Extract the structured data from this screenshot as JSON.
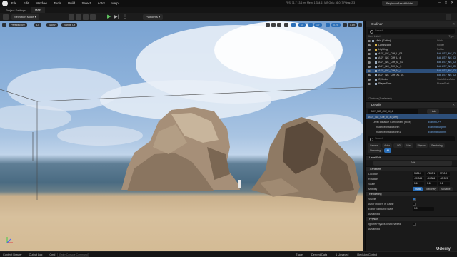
{
  "menu": [
    "File",
    "Edit",
    "Window",
    "Tools",
    "Build",
    "Select",
    "Actor",
    "Help"
  ],
  "stats": "FPS: 71.7   13.6 ms   Mem: 1,334.61 MB   Objs: 36,017   Prims: 2,3",
  "project_name": "BeginnerAssetHoldet",
  "tabs": {
    "project": "Project Settings",
    "level": "Main"
  },
  "toolbar": {
    "mode": "Selection Mode",
    "platforms": "Platforms"
  },
  "viewport": {
    "perspective": "Perspective",
    "lit": "Lit",
    "show": "Show",
    "buildhd": "Nanite Of",
    "snap1": "10",
    "snap2": "10°",
    "snap3": "0.25",
    "speed": "0.89"
  },
  "outliner": {
    "title": "Outliner",
    "search": "Search",
    "col_label": "Item Label",
    "col_type": "Type",
    "rows": [
      {
        "label": "Main (Editor)",
        "type": "World"
      },
      {
        "label": "Landscape",
        "type": "Folder"
      },
      {
        "label": "Lighting",
        "type": "Folder"
      },
      {
        "label": "ASY_NC_Cliff_L_03",
        "type": "Edit ASY_NC_Cli"
      },
      {
        "label": "ASY_NC_Cliff_L_4",
        "type": "Edit ASY_NC_Cli"
      },
      {
        "label": "ASY_NC_Cliff_M_02",
        "type": "Edit ASY_NC_Cli"
      },
      {
        "label": "ASY_NC_Cliff_M_3",
        "type": "Edit ASY_NC_Cli"
      },
      {
        "label": "ASY_NC_Cliff_M_4",
        "type": "Edit ASY_NC_Cli"
      },
      {
        "label": "ASY_NC_Cliff_XL_01",
        "type": "Edit ASY_NC_Cli"
      },
      {
        "label": "Cylinder",
        "type": "StaticMeshActor"
      },
      {
        "label": "PlayerStart",
        "type": "PlayerStart"
      }
    ],
    "footer": "17 actors (1 selected)"
  },
  "details": {
    "title": "Details",
    "actor": "ASY_NC_Cliff_M_4",
    "add": "+ Add",
    "instance": "ASY_NC_Cliff_M_4 (Self)",
    "components": [
      {
        "label": "Level Instance Component (Root)",
        "action": "Edit in C++"
      },
      {
        "label": "InstancedStaticMesh",
        "action": "Edit in Blueprint"
      },
      {
        "label": "InstancedStaticMesh1",
        "action": "Edit in Blueprint"
      }
    ],
    "search": "Search",
    "categories": [
      "General",
      "Actor",
      "LOD",
      "Misc",
      "Physics",
      "Rendering",
      "Streaming",
      "All"
    ],
    "level_edit": {
      "section": "Level Edit",
      "button": "Edit"
    },
    "transform": {
      "section": "Transform",
      "rows": [
        {
          "name": "Location",
          "x": "3086.0",
          "y": "-7853.1",
          "z": "7740.9"
        },
        {
          "name": "Rotation",
          "x": "-30.344",
          "y": "-34.386",
          "z": "-13.929"
        },
        {
          "name": "Scale",
          "x": "1.6",
          "y": "1.6",
          "z": "1.6"
        }
      ],
      "mobility": {
        "label": "Mobility",
        "options": [
          "Static",
          "Stationary",
          "Movable"
        ]
      }
    },
    "rendering": {
      "section": "Rendering",
      "rows": [
        {
          "label": "Visible",
          "checked": true
        },
        {
          "label": "Actor Hidden In Game",
          "checked": false
        },
        {
          "label": "Editor Billboard Scale",
          "value": "1.0"
        }
      ],
      "advanced": "Advanced"
    },
    "physics": {
      "section": "Physics",
      "row": "Ignore Physics Test Enabled",
      "advanced": "Advanced"
    }
  },
  "bottombar": {
    "drawer": "Content Drawer",
    "log": "Output Log",
    "cmd": "Cmd",
    "cmd_placeholder": "Enter Console Command",
    "trace": "Trace",
    "derived": "Derived Data",
    "unsaved": "1 Unsaved",
    "revision": "Revision Control"
  },
  "watermark": "Udemy"
}
